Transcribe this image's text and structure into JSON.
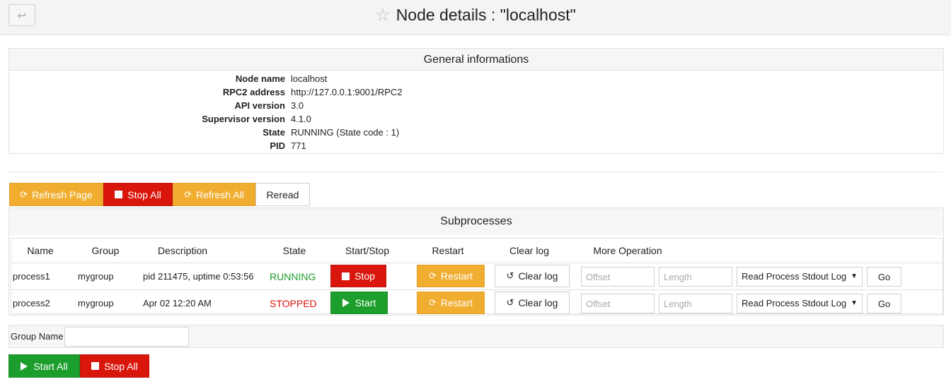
{
  "header": {
    "title": "Node details : \"localhost\"",
    "back_icon": "↩"
  },
  "info": {
    "heading": "General informations",
    "fields": [
      {
        "key": "Node name",
        "value": "localhost"
      },
      {
        "key": "RPC2 address",
        "value": "http://127.0.0.1:9001/RPC2"
      },
      {
        "key": "API version",
        "value": "3.0"
      },
      {
        "key": "Supervisor version",
        "value": "4.1.0"
      },
      {
        "key": "State",
        "value": "RUNNING (State code : 1)"
      },
      {
        "key": "PID",
        "value": "771"
      }
    ]
  },
  "toolbar": {
    "refresh_page": "Refresh Page",
    "stop_all": "Stop All",
    "refresh_all": "Refresh All",
    "reread": "Reread"
  },
  "subprocesses": {
    "heading": "Subprocesses",
    "columns": [
      "Name",
      "Group",
      "Description",
      "State",
      "Start/Stop",
      "Restart",
      "Clear log",
      "More Operation"
    ],
    "rows": [
      {
        "name": "process1",
        "group": "mygroup",
        "description": "pid 211475, uptime 0:53:56",
        "state": "RUNNING",
        "action": "Stop",
        "restart": "Restart",
        "clear": "Clear log",
        "offset_ph": "Offset",
        "length_ph": "Length",
        "operation": "Read Process Stdout Log",
        "go": "Go"
      },
      {
        "name": "process2",
        "group": "mygroup",
        "description": "Apr 02 12:20 AM",
        "state": "STOPPED",
        "action": "Start",
        "restart": "Restart",
        "clear": "Clear log",
        "offset_ph": "Offset",
        "length_ph": "Length",
        "operation": "Read Process Stdout Log",
        "go": "Go"
      }
    ]
  },
  "group": {
    "label": "Group Name",
    "value": ""
  },
  "bottom": {
    "start_all": "Start All",
    "stop_all": "Stop All"
  },
  "colors": {
    "orange": "#f0ad2f",
    "red": "#d9160c",
    "green": "#1b9e2c"
  }
}
